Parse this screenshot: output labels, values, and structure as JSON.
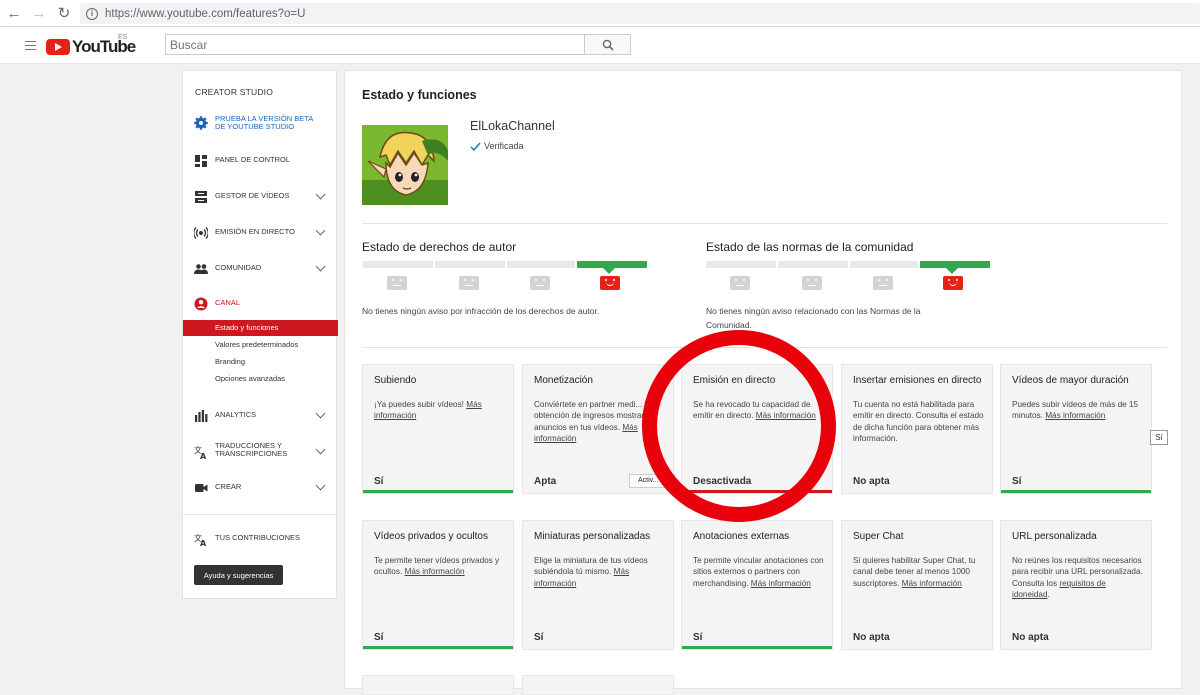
{
  "browser": {
    "url": "https://www.youtube.com/features?o=U"
  },
  "header": {
    "logo_text": "YouTube",
    "region": "ES",
    "search_placeholder": "Buscar"
  },
  "sidebar": {
    "title": "CREATOR STUDIO",
    "beta_line1": "PRUEBA LA VERSIÓN BETA",
    "beta_line2": "DE YOUTUBE STUDIO",
    "items": [
      {
        "label": "PANEL DE CONTROL"
      },
      {
        "label": "GESTOR DE VÍDEOS"
      },
      {
        "label": "EMISIÓN EN DIRECTO"
      },
      {
        "label": "COMUNIDAD"
      },
      {
        "label": "CANAL"
      },
      {
        "label": "ANALYTICS"
      },
      {
        "label_line1": "TRADUCCIONES Y",
        "label_line2": "TRANSCRIPCIONES"
      },
      {
        "label": "CREAR"
      },
      {
        "label": "TUS CONTRIBUCIONES"
      }
    ],
    "sub_items": [
      "Estado y funciones",
      "Valores predeterminados",
      "Branding",
      "Opciones avanzadas"
    ],
    "help_button": "Ayuda y sugerencias"
  },
  "main": {
    "title": "Estado y funciones",
    "channel_name": "ElLokaChannel",
    "verified_label": "Verificada",
    "copyright": {
      "title": "Estado de derechos de autor",
      "text": "No tienes ningún aviso por infracción de los derechos de autor."
    },
    "community": {
      "title": "Estado de las normas de la comunidad",
      "text_line1": "No tienes ningún aviso relacionado con las Normas de la",
      "text_line2": "Comunidad."
    },
    "cards": [
      {
        "title": "Subiendo",
        "desc": "¡Ya puedes subir vídeos! ",
        "link": "Más información",
        "status": "Sí",
        "color": "green"
      },
      {
        "title": "Monetización",
        "desc": "Conviértete en partner medi... la obtención de ingresos mostrando anuncios en tus vídeos. ",
        "link": "Más información",
        "status": "Apta",
        "color": "none",
        "button": "Activ..."
      },
      {
        "title": "Emisión en directo",
        "desc": "Se ha revocado tu capacidad de emitir en directo. ",
        "link": "Más información",
        "status": "Desactivada",
        "color": "red"
      },
      {
        "title": "Insertar emisiones en directo",
        "desc": "Tu cuenta no está habilitada para emitir en directo. Consulta el estado de dicha función para obtener más información.",
        "link": "",
        "status": "No apta",
        "color": "none"
      },
      {
        "title": "Vídeos de mayor duración",
        "desc": "Puedes subir vídeos de más de 15 minutos. ",
        "link": "Más información",
        "status": "Sí",
        "color": "green"
      },
      {
        "title": "Vídeos privados y ocultos",
        "desc": "Te permite tener vídeos privados y ocultos. ",
        "link": "Más información",
        "status": "Sí",
        "color": "green"
      },
      {
        "title": "Miniaturas personalizadas",
        "desc": "Elige la miniatura de tus vídeos subiéndola tú mismo. ",
        "link": "Más información",
        "status": "Sí",
        "color": "none"
      },
      {
        "title": "Anotaciones externas",
        "desc": "Te permite vincular anotaciones con sitios externos o partners con merchandising. ",
        "link": "Más información",
        "status": "Sí",
        "color": "green"
      },
      {
        "title": "Super Chat",
        "desc": "Si quieres habilitar Super Chat, tu canal debe tener al menos 1000 suscriptores. ",
        "link": "Más información",
        "status": "No apta",
        "color": "none"
      },
      {
        "title": "URL personalizada",
        "desc": "No reúnes los requisitos necesarios para recibir una URL personalizada. Consulta los ",
        "link": "requisitos de idoneidad",
        "suffix": ".",
        "status": "No apta",
        "color": "none"
      }
    ],
    "tooltip": "Sí"
  },
  "colors": {
    "accent_red": "#cc181e",
    "green": "#2fa84f",
    "annotation_circle": "#e8000a"
  }
}
